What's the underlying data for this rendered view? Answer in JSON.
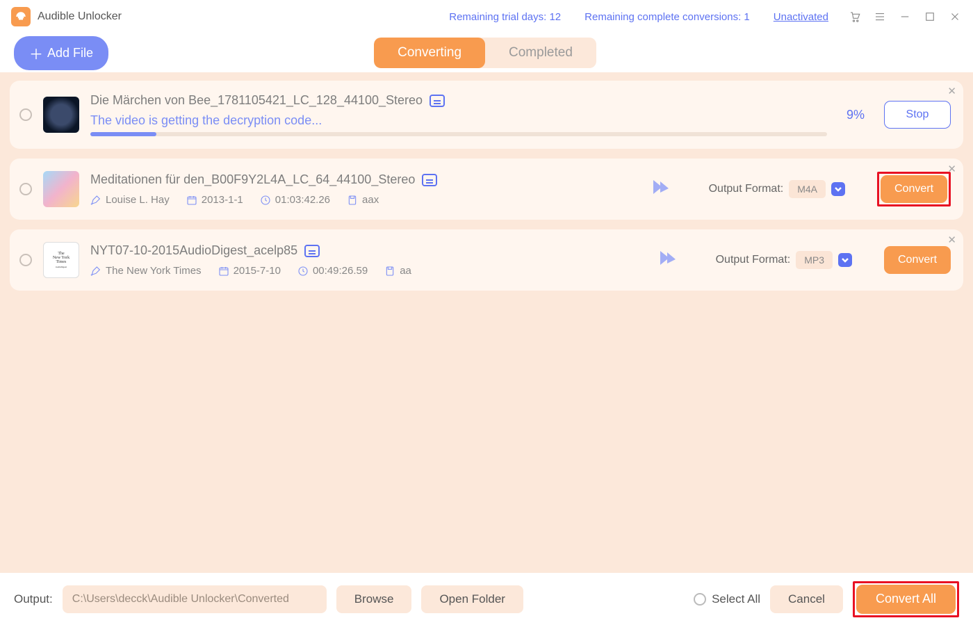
{
  "header": {
    "app_title": "Audible Unlocker",
    "trial_days": "Remaining trial days: 12",
    "remaining_conversions": "Remaining complete conversions: 1",
    "unactivated": "Unactivated"
  },
  "toolbar": {
    "add_file": "Add File",
    "tab_converting": "Converting",
    "tab_completed": "Completed"
  },
  "items": [
    {
      "title": "Die Märchen von Bee_1781105421_LC_128_44100_Stereo",
      "status": "The video is getting the decryption code...",
      "percent": "9%",
      "stop": "Stop"
    },
    {
      "title": "Meditationen für den_B00F9Y2L4A_LC_64_44100_Stereo",
      "author": "Louise L. Hay",
      "date": "2013-1-1",
      "duration": "01:03:42.26",
      "ext": "aax",
      "output_label": "Output Format:",
      "format": "M4A",
      "convert": "Convert"
    },
    {
      "title": "NYT07-10-2015AudioDigest_acelp85",
      "author": "The New York Times",
      "date": "2015-7-10",
      "duration": "00:49:26.59",
      "ext": "aa",
      "output_label": "Output Format:",
      "format": "MP3",
      "convert": "Convert"
    }
  ],
  "footer": {
    "out_label": "Output:",
    "out_path": "C:\\Users\\decck\\Audible Unlocker\\Converted",
    "browse": "Browse",
    "open_folder": "Open Folder",
    "select_all": "Select All",
    "cancel": "Cancel",
    "convert_all": "Convert All"
  }
}
